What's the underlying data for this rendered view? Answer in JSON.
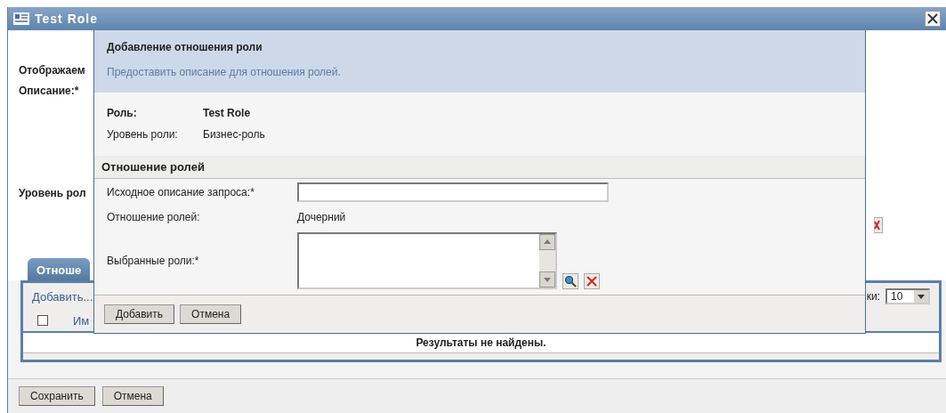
{
  "window": {
    "title": "Test Role"
  },
  "form": {
    "fields": [
      {
        "label": "Отображаем"
      },
      {
        "label": "Описание:*"
      },
      {
        "label": "Уровень рол"
      }
    ]
  },
  "tabs": [
    {
      "label": "Отноше",
      "selected": true
    }
  ],
  "table": {
    "toolbar_link": "Добавить...",
    "rows_per_page_label": "ки:",
    "rows_per_page": "10",
    "select_all_checked": false,
    "columns": [
      "Им"
    ],
    "empty_message": "Результаты не найдены."
  },
  "buttons": [
    "Сохранить",
    "Отмена"
  ],
  "dialog": {
    "title": "Добавление отношения роли",
    "description": "Предоставить описание для отношения ролей.",
    "info": [
      {
        "label": "Роль:",
        "value": "Test Role",
        "bold": true
      },
      {
        "label": "Уровень роли:",
        "value": "Бизнес-роль",
        "bold": false
      }
    ],
    "section_title": "Отношение ролей",
    "fields": [
      {
        "kind": "input",
        "label": "Исходное описание запроса:*"
      },
      {
        "kind": "static",
        "label": "Отношение ролей:",
        "value": "Дочерний"
      },
      {
        "kind": "list",
        "label": "Выбранные роли:*"
      }
    ],
    "buttons": [
      "Добавить",
      "Отмена"
    ]
  }
}
